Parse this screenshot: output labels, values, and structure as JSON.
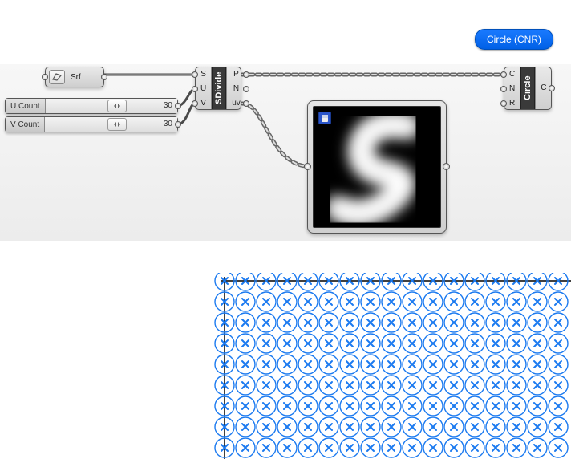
{
  "tooltip": {
    "text": "Circle (CNR)"
  },
  "srf_param": {
    "label": "Srf",
    "icon_name": "surface-icon"
  },
  "sdivide": {
    "name": "SDivide",
    "inputs": [
      {
        "label": "S"
      },
      {
        "label": "U"
      },
      {
        "label": "V"
      }
    ],
    "outputs": [
      {
        "label": "P"
      },
      {
        "label": "N"
      },
      {
        "label": "uv"
      }
    ]
  },
  "circle_node": {
    "name": "Circle",
    "inputs": [
      {
        "label": "C"
      },
      {
        "label": "N"
      },
      {
        "label": "R"
      }
    ],
    "outputs": [
      {
        "label": "C"
      }
    ]
  },
  "sliders": {
    "u": {
      "name": "U Count",
      "value": "30"
    },
    "v": {
      "name": "V Count",
      "value": "30"
    }
  },
  "sampler": {
    "has_save_icon": true
  },
  "viewport": {
    "grid_cols": 17,
    "grid_rows": 9,
    "circle_stroke": "#1b7af0",
    "marker_stroke": "#1b7af0",
    "axis_color": "#000000"
  }
}
